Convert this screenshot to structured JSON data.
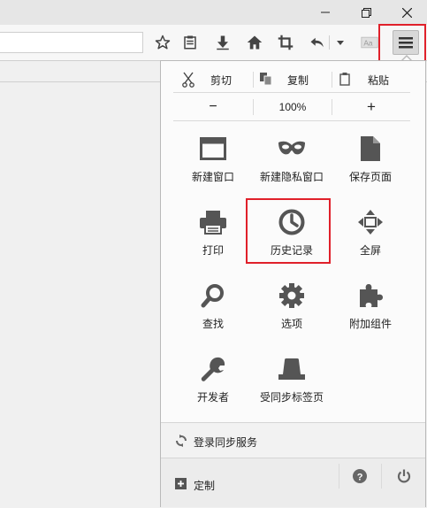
{
  "window_controls": {
    "minimize_icon": "minimize-icon",
    "maximize_icon": "restore-icon",
    "close_icon": "close-icon"
  },
  "toolbar": {
    "icons": [
      "star-icon",
      "reading-list-icon",
      "download-icon",
      "home-icon",
      "crop-icon",
      "undo-icon",
      "chevron-down-icon",
      "font-icon",
      "hamburger-menu-icon"
    ]
  },
  "menu_panel": {
    "edit": {
      "cut_label": "剪切",
      "copy_label": "复制",
      "paste_label": "粘贴"
    },
    "zoom": {
      "minus_label": "−",
      "value": "100%",
      "plus_label": "+"
    },
    "items": [
      {
        "label": "新建窗口",
        "icon": "window-icon"
      },
      {
        "label": "新建隐私窗口",
        "icon": "private-mask-icon"
      },
      {
        "label": "保存页面",
        "icon": "save-page-icon"
      },
      {
        "label": "打印",
        "icon": "printer-icon"
      },
      {
        "label": "历史记录",
        "icon": "history-clock-icon"
      },
      {
        "label": "全屏",
        "icon": "fullscreen-icon"
      },
      {
        "label": "查找",
        "icon": "search-icon"
      },
      {
        "label": "选项",
        "icon": "gear-icon"
      },
      {
        "label": "附加组件",
        "icon": "puzzle-icon"
      },
      {
        "label": "开发者",
        "icon": "wrench-icon"
      },
      {
        "label": "受同步标签页",
        "icon": "synced-tabs-icon"
      }
    ],
    "sync_label": "登录同步服务",
    "customize_label": "定制"
  },
  "colors": {
    "highlight": "#e0202a",
    "icon": "#555555"
  }
}
